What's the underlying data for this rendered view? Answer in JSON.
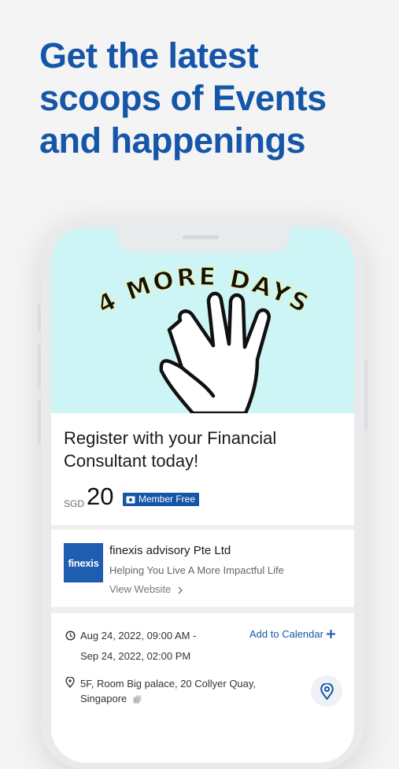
{
  "headline": "Get the latest scoops of Events and happenings",
  "banner": {
    "text": "4 MORE DAYS",
    "icon": "four-fingers-hand-icon",
    "bg_color": "#cdf5f6"
  },
  "event": {
    "title": "Register with your Financial Consultant today!",
    "currency": "SGD",
    "price": "20",
    "badge": "Member Free"
  },
  "organizer": {
    "logo_text": "finexis",
    "name": "finexis advisory Pte Ltd",
    "tagline": "Helping You Live A More Impactful Life",
    "link": "View Website"
  },
  "details": {
    "date_start": "Aug 24, 2022, 09:00 AM -",
    "date_end": "Sep 24, 2022, 02:00 PM",
    "calendar_label": "Add to Calendar",
    "address": "5F, Room Big palace, 20 Collyer Quay, Singapore"
  },
  "colors": {
    "brand_blue": "#1556a8",
    "background": "#f4f4f5"
  }
}
